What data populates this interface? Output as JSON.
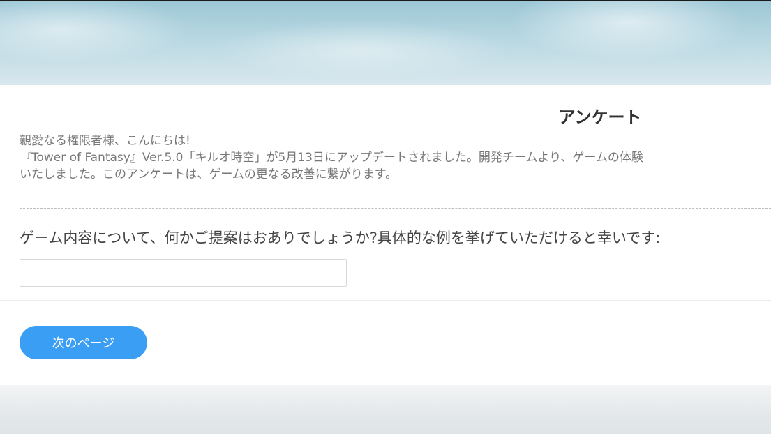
{
  "survey": {
    "title": "アンケート",
    "intro": {
      "line1": "親愛なる権限者様、こんにちは!",
      "line2": "『Tower of Fantasy』Ver.5.0「キルオ時空」が5月13日にアップデートされました。開発チームより、ゲームの体験",
      "line3": "いたしました。このアンケートは、ゲームの更なる改善に繋がります。"
    },
    "question": "ゲーム内容について、何かご提案はおありでしょうか?具体的な例を挙げていただけると幸いです:",
    "answer_value": "",
    "next_label": "次のページ"
  },
  "colors": {
    "button": "#3a9ef5",
    "card": "#ffffff"
  }
}
